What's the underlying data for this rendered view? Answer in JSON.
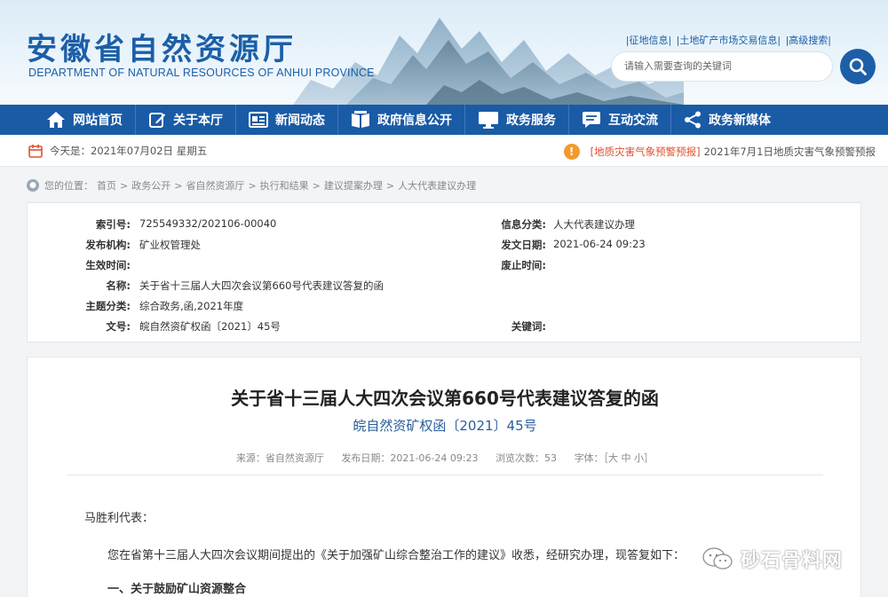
{
  "header": {
    "title_cn": "安徽省自然资源厅",
    "title_en": "DEPARTMENT OF NATURAL RESOURCES OF ANHUI PROVINCE",
    "top_links": [
      "|征地信息|",
      "|土地矿产市场交易信息|",
      "|高级搜索|"
    ],
    "search_placeholder": "请输入需要查询的关键词"
  },
  "nav": {
    "items": [
      {
        "label": "网站首页",
        "icon": "home-icon"
      },
      {
        "label": "关于本厅",
        "icon": "edit-icon"
      },
      {
        "label": "新闻动态",
        "icon": "news-icon"
      },
      {
        "label": "政府信息公开",
        "icon": "book-icon"
      },
      {
        "label": "政务服务",
        "icon": "monitor-icon"
      },
      {
        "label": "互动交流",
        "icon": "chat-icon"
      },
      {
        "label": "政务新媒体",
        "icon": "share-icon"
      }
    ]
  },
  "datebar": {
    "date_text": "今天是：2021年07月02日 星期五",
    "notice_tag": "[地质灾害气象预警预报]",
    "notice_text": "2021年7月1日地质灾害气象预警预报"
  },
  "breadcrumb": {
    "prefix": "您的位置：",
    "items": [
      "首页",
      "政务公开",
      "省自然资源厅",
      "执行和结果",
      "建议提案办理",
      "人大代表建议办理"
    ],
    "sep": ">"
  },
  "meta": {
    "index_label": "索引号:",
    "index_value": "725549332/202106-00040",
    "category_label": "信息分类:",
    "category_value": "人大代表建议办理",
    "publisher_label": "发布机构:",
    "publisher_value": "矿业权管理处",
    "date_label": "发文日期:",
    "date_value": "2021-06-24 09:23",
    "effective_label": "生效时间:",
    "effective_value": "",
    "expire_label": "废止时间:",
    "expire_value": "",
    "name_label": "名称:",
    "name_value": "关于省十三届人大四次会议第660号代表建议答复的函",
    "subject_label": "主题分类:",
    "subject_value": "综合政务,函,2021年度",
    "docno_label": "文号:",
    "docno_value": "皖自然资矿权函〔2021〕45号",
    "keywords_label": "关键词:",
    "keywords_value": ""
  },
  "document": {
    "title": "关于省十三届人大四次会议第660号代表建议答复的函",
    "doc_number": "皖自然资矿权函〔2021〕45号",
    "source": "来源：省自然资源厅",
    "publish_date": "发布日期：2021-06-24 09:23",
    "views": "浏览次数：53",
    "font_size": "字体：［大 中 小］",
    "salutation": "马胜利代表：",
    "para1": "您在省第十三届人大四次会议期间提出的《关于加强矿山综合整治工作的建议》收悉，经研究办理，现答复如下：",
    "section1": "一、关于鼓励矿山资源整合"
  },
  "watermark": {
    "text": "砂石骨料网"
  },
  "colors": {
    "brand_blue": "#1a5ba6",
    "warning_orange": "#f39a2b",
    "notice_red": "#e1502f"
  }
}
